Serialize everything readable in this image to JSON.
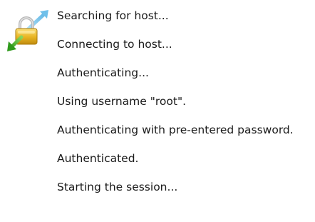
{
  "icon": "secure-connection-lock-icon",
  "colors": {
    "lock_gold": "#e8b422",
    "arrow_blue": "#7cc6ec",
    "arrow_green": "#3fae2a",
    "text": "#1a1a1a",
    "background": "#ffffff"
  },
  "log": [
    "Searching for host...",
    "Connecting to host...",
    "Authenticating...",
    "Using username \"root\".",
    "Authenticating with pre-entered password.",
    "Authenticated.",
    "Starting the session..."
  ]
}
